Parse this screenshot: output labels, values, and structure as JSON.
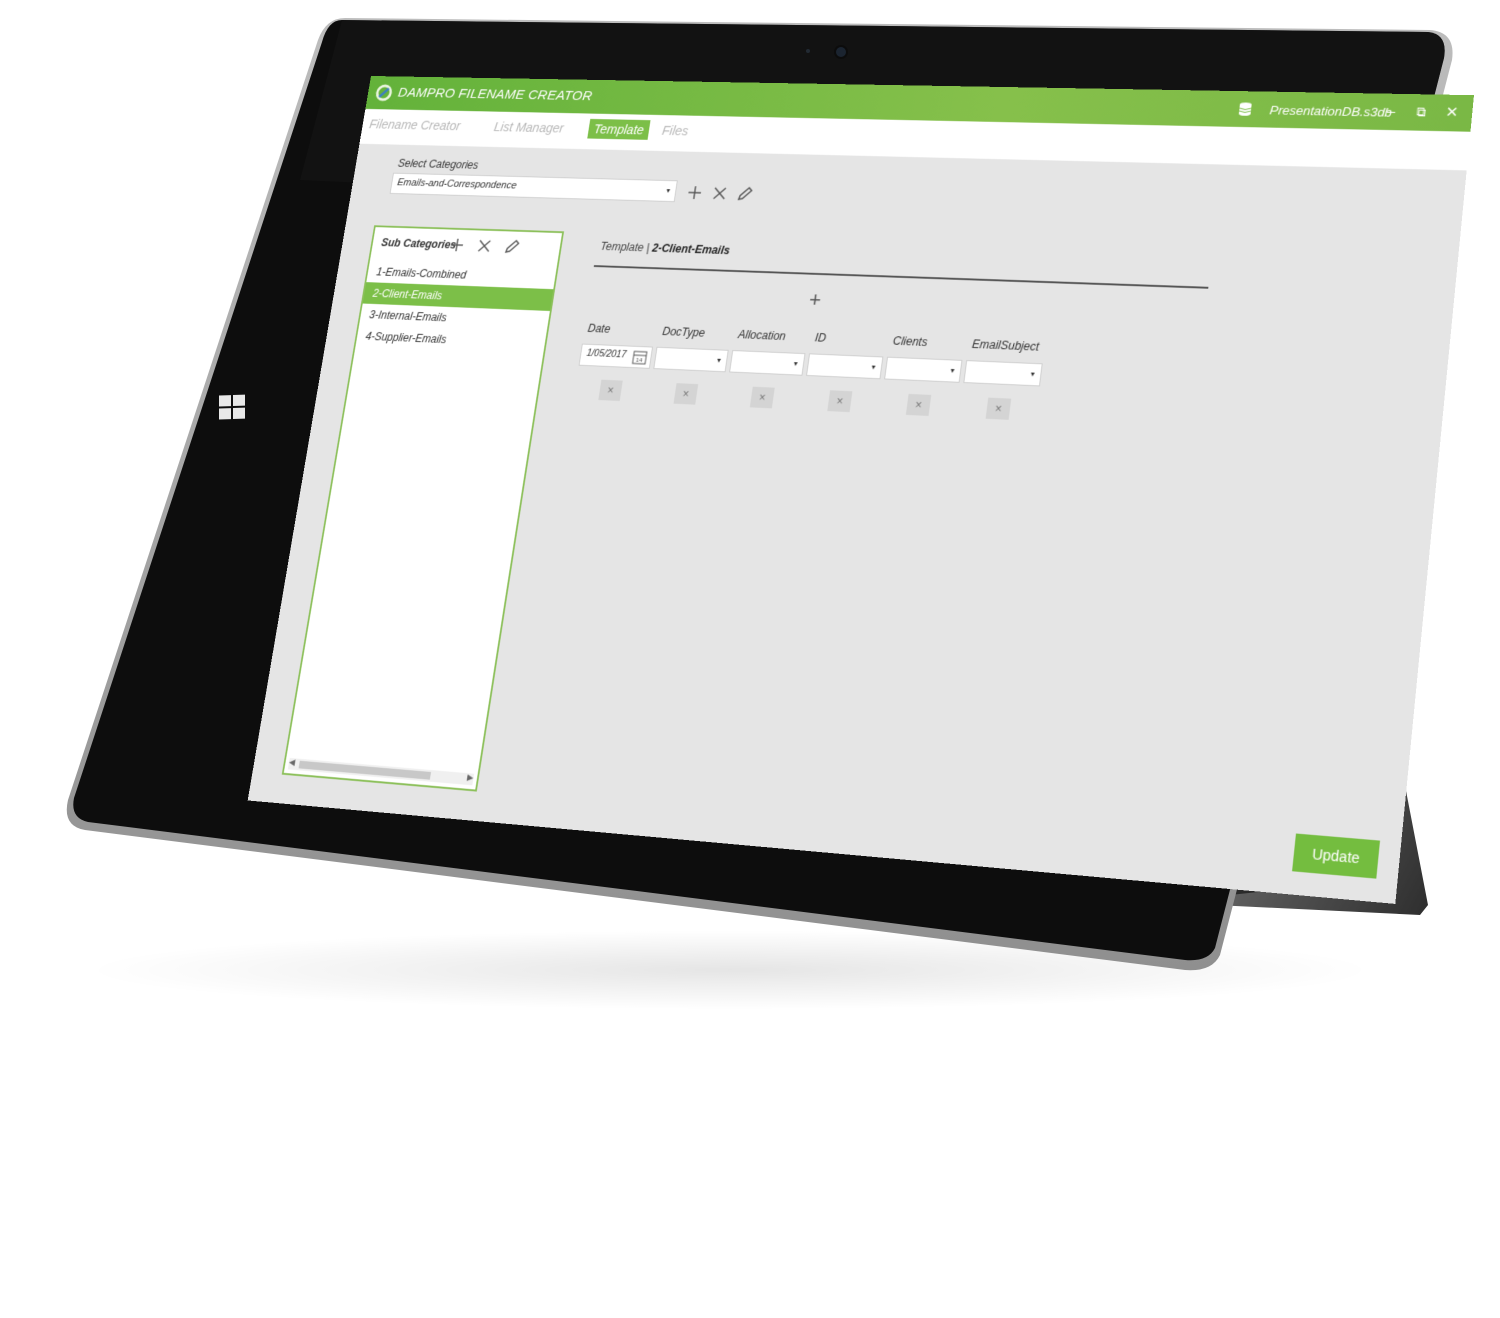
{
  "window": {
    "title": "DAMPRO FILENAME CREATOR",
    "database": "PresentationDB.s3db",
    "minimize_glyph": "–",
    "restore_glyph": "⧉",
    "close_glyph": "✕"
  },
  "tabs": [
    {
      "label": "Filename Creator",
      "active": false
    },
    {
      "label": "List Manager",
      "active": false
    },
    {
      "label": "Template",
      "active": true
    },
    {
      "label": "Files",
      "active": false
    }
  ],
  "category": {
    "label": "Select Categories",
    "selected": "Emails-and-Correspondence"
  },
  "subcategories": {
    "header": "Sub Categories",
    "items": [
      {
        "label": "1-Emails-Combined",
        "selected": false
      },
      {
        "label": "2-Client-Emails",
        "selected": true
      },
      {
        "label": "3-Internal-Emails",
        "selected": false
      },
      {
        "label": "4-Supplier-Emails",
        "selected": false
      }
    ]
  },
  "template": {
    "breadcrumb_prefix": "Template |",
    "breadcrumb_current": "2-Client-Emails",
    "add_glyph": "+",
    "remove_glyph": "×",
    "fields": [
      {
        "label": "Date",
        "value": "1/05/2017",
        "kind": "date"
      },
      {
        "label": "DocType",
        "value": "",
        "kind": "select"
      },
      {
        "label": "Allocation",
        "value": "",
        "kind": "select"
      },
      {
        "label": "ID",
        "value": "",
        "kind": "select"
      },
      {
        "label": "Clients",
        "value": "",
        "kind": "select"
      },
      {
        "label": "EmailSubject",
        "value": "",
        "kind": "select"
      }
    ]
  },
  "footer": {
    "update_label": "Update"
  },
  "icons": {
    "caret": "▾",
    "add": "plus-icon",
    "delete": "x-icon",
    "edit": "pencil-icon",
    "calendar": "calendar-icon",
    "database": "database-icon"
  },
  "colors": {
    "accent": "#7cbf48",
    "titlebar": "#6cb640",
    "bezel": "#0d0d0d",
    "screen_bg": "#e5e5e5"
  }
}
